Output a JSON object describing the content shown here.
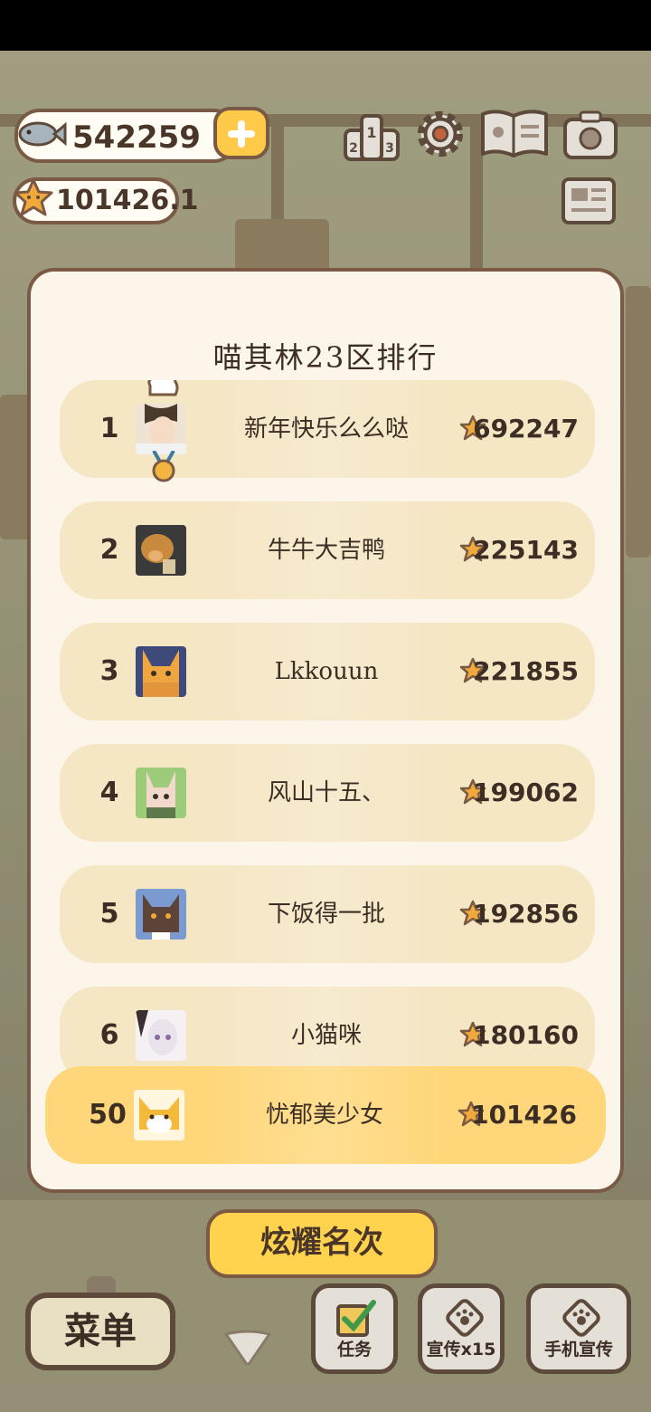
{
  "currency": {
    "fish": "542259",
    "stars": "101426.1"
  },
  "top_icons": [
    "ranking-icon",
    "settings-icon",
    "recipe-book-icon",
    "camera-icon",
    "news-icon"
  ],
  "leaderboard": {
    "title": "喵其林23区排行",
    "rows": [
      {
        "rank": "1",
        "name": "新年快乐么么哒",
        "score": "692247",
        "avatar": "chef-portrait"
      },
      {
        "rank": "2",
        "name": "牛牛大吉鸭",
        "score": "225143",
        "avatar": "dog-photo"
      },
      {
        "rank": "3",
        "name": "Lkkouun",
        "score": "221855",
        "avatar": "orange-cat"
      },
      {
        "rank": "4",
        "name": "风山十五、",
        "score": "199062",
        "avatar": "bunny"
      },
      {
        "rank": "5",
        "name": "下饭得一批",
        "score": "192856",
        "avatar": "brown-cat"
      },
      {
        "rank": "6",
        "name": "小猫咪",
        "score": "180160",
        "avatar": "anime-girl"
      }
    ],
    "mine": {
      "rank": "50",
      "name": "忧郁美少女",
      "score": "101426",
      "avatar": "shiba"
    }
  },
  "buttons": {
    "show_rank": "炫耀名次",
    "menu": "菜单",
    "task": "任务",
    "promo": "宣传x15",
    "phone_promo": "手机宣传"
  },
  "colors": {
    "accent": "#FFD34E",
    "row": "#F5E6C4",
    "row_mine": "#FFD77A",
    "border": "#7A5A44"
  }
}
